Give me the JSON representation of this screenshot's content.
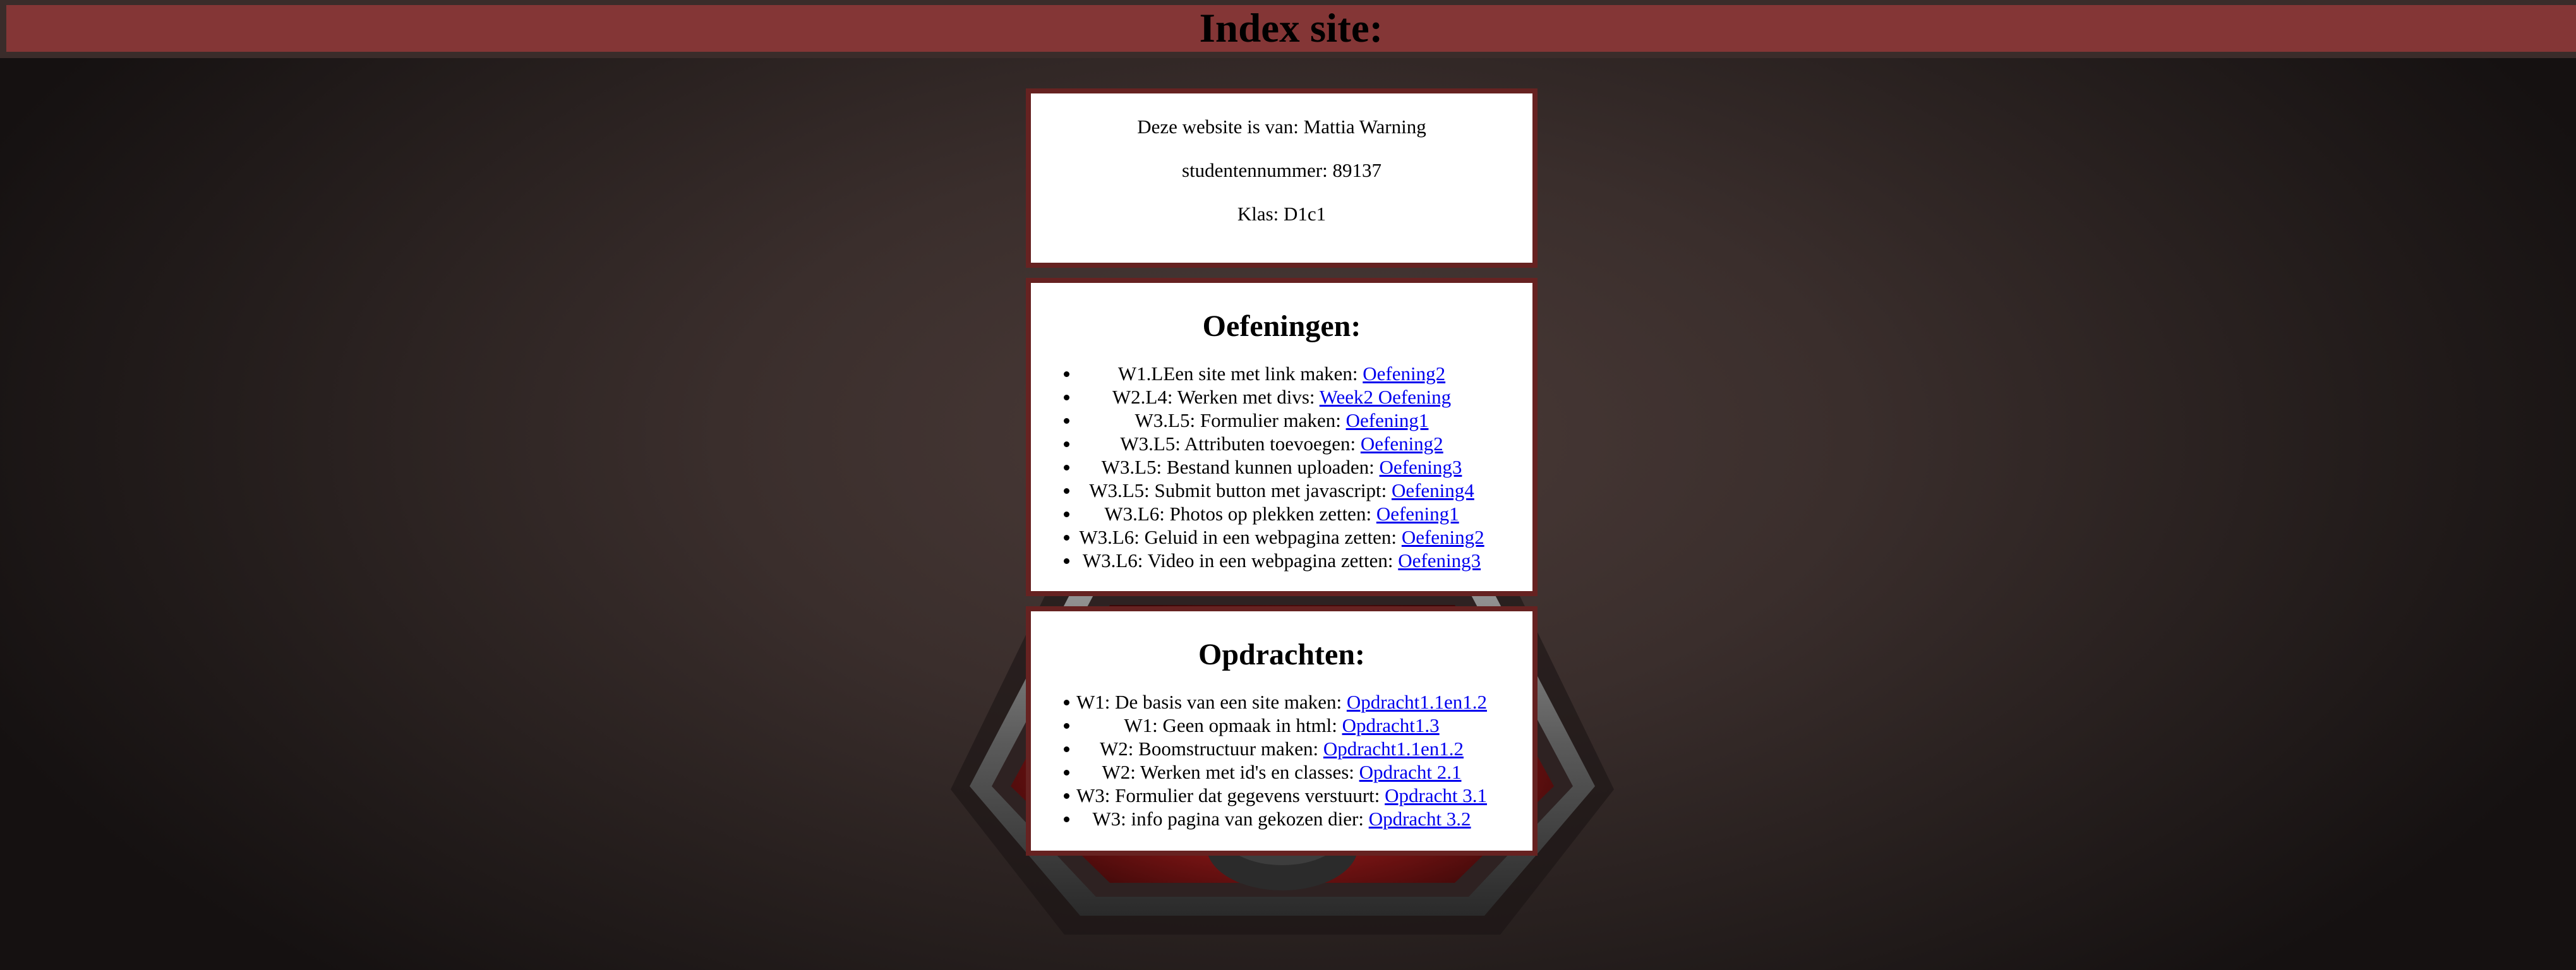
{
  "header": {
    "title": "Index site:"
  },
  "info": {
    "owner": "Deze website is van: Mattia Warning",
    "student_number": "studentennummer: 89137",
    "class": "Klas: D1c1"
  },
  "oefeningen": {
    "title": "Oefeningen:",
    "items": [
      {
        "text": "W1.LEen site met link maken: ",
        "link": "Oefening2"
      },
      {
        "text": "W2.L4: Werken met divs: ",
        "link": "Week2 Oefening"
      },
      {
        "text": "W3.L5: Formulier maken: ",
        "link": "Oefening1"
      },
      {
        "text": "W3.L5: Attributen toevoegen: ",
        "link": "Oefening2"
      },
      {
        "text": "W3.L5: Bestand kunnen uploaden: ",
        "link": "Oefening3"
      },
      {
        "text": "W3.L5: Submit button met javascript: ",
        "link": "Oefening4"
      },
      {
        "text": "W3.L6: Photos op plekken zetten: ",
        "link": "Oefening1"
      },
      {
        "text": "W3.L6: Geluid in een webpagina zetten: ",
        "link": "Oefening2"
      },
      {
        "text": "W3.L6: Video in een webpagina zetten: ",
        "link": "Oefening3"
      }
    ]
  },
  "opdrachten": {
    "title": "Opdrachten:",
    "items": [
      {
        "text": "W1: De basis van een site maken: ",
        "link": "Opdracht1.1en1.2"
      },
      {
        "text": "W1: Geen opmaak in html: ",
        "link": "Opdracht1.3"
      },
      {
        "text": "W2: Boomstructuur maken: ",
        "link": "Opdracht1.1en1.2"
      },
      {
        "text": "W2: Werken met id's en classes: ",
        "link": "Opdracht 2.1"
      },
      {
        "text": "W3: Formulier dat gegevens verstuurt: ",
        "link": "Opdracht 3.1"
      },
      {
        "text": "W3: info pagina van gekozen dier: ",
        "link": "Opdracht 3.2"
      }
    ]
  },
  "colors": {
    "header_bar": "#843636",
    "card_border": "#662221",
    "link": "#0000ee",
    "background": "#3a2e2c"
  },
  "background_icon": "hexagon-emblem-icon"
}
